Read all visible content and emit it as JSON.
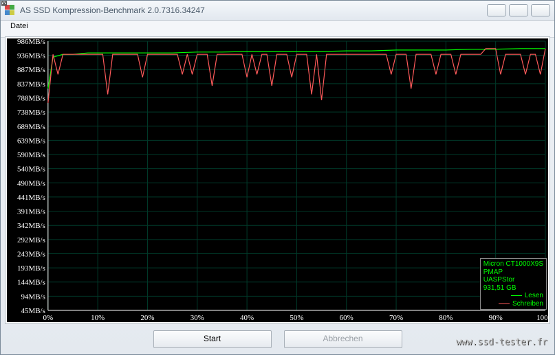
{
  "title": "AS SSD Kompression-Benchmark 2.0.7316.34247",
  "menu": {
    "datei": "Datei"
  },
  "buttons": {
    "start": "Start",
    "abort": "Abbrechen"
  },
  "legend": {
    "device": "Micron CT1000X9S",
    "pmap": "PMAP",
    "controller": "UASPStor",
    "capacity": "931,51 GB",
    "read": "Lesen",
    "write": "Schreiben",
    "read_color": "#00ff00",
    "write_color": "#ff5a5a"
  },
  "watermark": "www.ssd-tester.fr",
  "chart_data": {
    "type": "line",
    "xlabel": "",
    "ylabel": "",
    "xlim": [
      0,
      100
    ],
    "ylim": [
      45,
      986
    ],
    "y_ticks": [
      "986MB/s",
      "936MB/s",
      "887MB/s",
      "837MB/s",
      "788MB/s",
      "738MB/s",
      "689MB/s",
      "639MB/s",
      "590MB/s",
      "540MB/s",
      "490MB/s",
      "441MB/s",
      "391MB/s",
      "342MB/s",
      "292MB/s",
      "243MB/s",
      "193MB/s",
      "144MB/s",
      "94MB/s",
      "45MB/s"
    ],
    "x_ticks": [
      "0%",
      "10%",
      "20%",
      "30%",
      "40%",
      "50%",
      "60%",
      "70%",
      "80%",
      "90%",
      "100%"
    ],
    "series": [
      {
        "name": "Lesen",
        "color": "#00ff00",
        "x": [
          0,
          1,
          2,
          3,
          5,
          8,
          10,
          15,
          20,
          25,
          30,
          35,
          40,
          45,
          50,
          55,
          60,
          65,
          70,
          75,
          80,
          85,
          90,
          95,
          100
        ],
        "y": [
          820,
          930,
          935,
          940,
          940,
          945,
          945,
          945,
          945,
          945,
          948,
          948,
          950,
          950,
          950,
          950,
          952,
          952,
          955,
          955,
          955,
          958,
          958,
          960,
          960
        ]
      },
      {
        "name": "Schreiben",
        "color": "#ff5a5a",
        "x": [
          0,
          1,
          2,
          3,
          4,
          5,
          6,
          7,
          8,
          9,
          10,
          11,
          12,
          13,
          14,
          15,
          16,
          17,
          18,
          19,
          20,
          21,
          22,
          23,
          24,
          25,
          26,
          27,
          28,
          29,
          30,
          31,
          32,
          33,
          34,
          35,
          36,
          37,
          38,
          39,
          40,
          41,
          42,
          43,
          44,
          45,
          46,
          47,
          48,
          49,
          50,
          51,
          52,
          53,
          54,
          55,
          56,
          57,
          58,
          59,
          60,
          61,
          62,
          63,
          64,
          65,
          66,
          67,
          68,
          69,
          70,
          71,
          72,
          73,
          74,
          75,
          76,
          77,
          78,
          79,
          80,
          81,
          82,
          83,
          84,
          85,
          86,
          87,
          88,
          89,
          90,
          91,
          92,
          93,
          94,
          95,
          96,
          97,
          98,
          99,
          100
        ],
        "y": [
          770,
          940,
          870,
          940,
          940,
          940,
          940,
          940,
          940,
          940,
          940,
          940,
          800,
          940,
          940,
          940,
          940,
          940,
          940,
          860,
          940,
          940,
          940,
          940,
          940,
          940,
          940,
          870,
          940,
          870,
          940,
          940,
          940,
          830,
          940,
          940,
          940,
          940,
          940,
          940,
          860,
          940,
          870,
          940,
          940,
          830,
          940,
          940,
          940,
          860,
          940,
          940,
          940,
          800,
          940,
          780,
          940,
          940,
          940,
          940,
          940,
          940,
          940,
          940,
          940,
          940,
          940,
          940,
          940,
          870,
          940,
          940,
          940,
          820,
          940,
          940,
          940,
          940,
          870,
          940,
          940,
          940,
          870,
          940,
          940,
          940,
          940,
          940,
          960,
          960,
          960,
          870,
          940,
          940,
          940,
          940,
          870,
          940,
          940,
          870,
          960
        ]
      }
    ]
  }
}
